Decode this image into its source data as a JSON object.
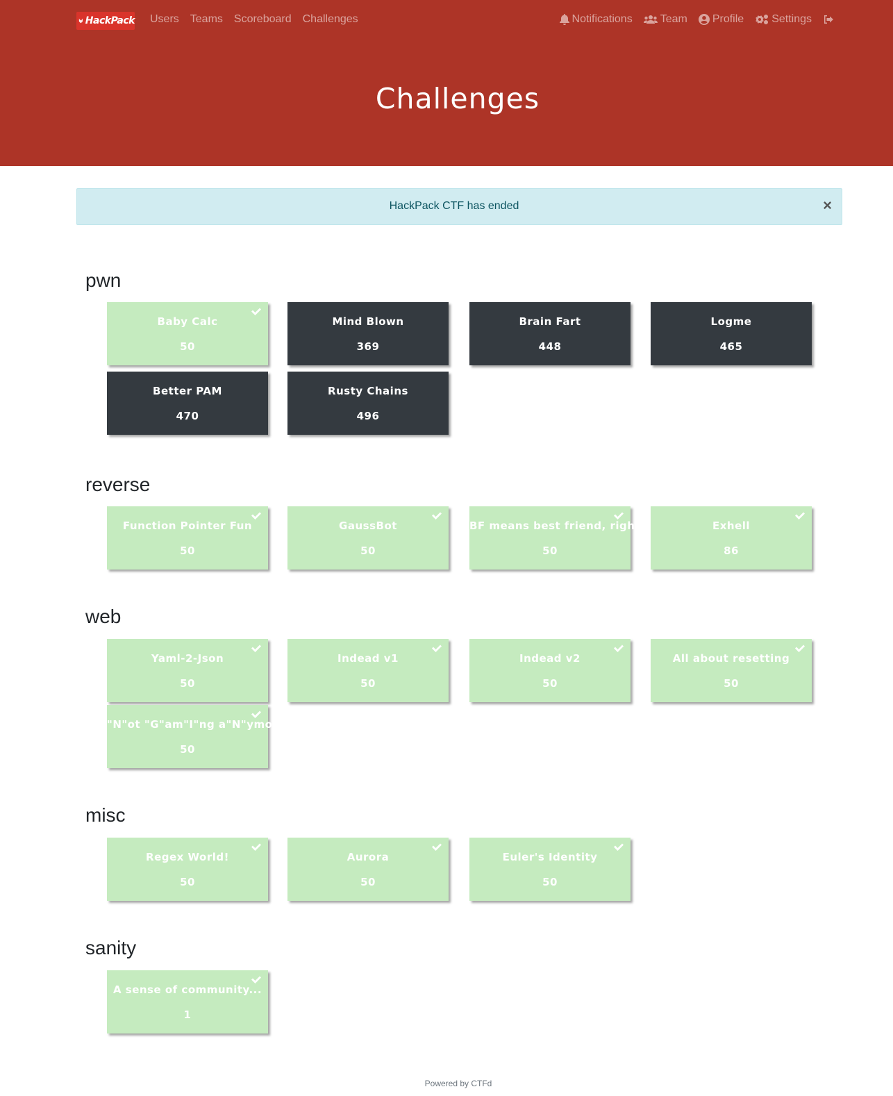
{
  "navbar": {
    "brand": "HackPack",
    "left_links": [
      "Users",
      "Teams",
      "Scoreboard",
      "Challenges"
    ],
    "right_items": [
      {
        "label": "Notifications",
        "icon": "bell-icon"
      },
      {
        "label": "Team",
        "icon": "users-icon"
      },
      {
        "label": "Profile",
        "icon": "user-circle-icon"
      },
      {
        "label": "Settings",
        "icon": "cogs-icon"
      }
    ],
    "logout_icon": "sign-out-icon"
  },
  "header": {
    "title": "Challenges"
  },
  "alert": {
    "message": "HackPack CTF has ended",
    "close": "×"
  },
  "categories": [
    {
      "name": "pwn",
      "challenges": [
        {
          "name": "Baby Calc",
          "points": "50",
          "solved": true
        },
        {
          "name": "Mind Blown",
          "points": "369",
          "solved": false
        },
        {
          "name": "Brain Fart",
          "points": "448",
          "solved": false
        },
        {
          "name": "Logme",
          "points": "465",
          "solved": false
        },
        {
          "name": "Better PAM",
          "points": "470",
          "solved": false
        },
        {
          "name": "Rusty Chains",
          "points": "496",
          "solved": false
        }
      ]
    },
    {
      "name": "reverse",
      "challenges": [
        {
          "name": "Function Pointer Fun",
          "points": "50",
          "solved": true
        },
        {
          "name": "GaussBot",
          "points": "50",
          "solved": true
        },
        {
          "name": "BF means best friend, right?",
          "points": "50",
          "solved": true
        },
        {
          "name": "Exhell",
          "points": "86",
          "solved": true
        }
      ]
    },
    {
      "name": "web",
      "challenges": [
        {
          "name": "Yaml-2-Json",
          "points": "50",
          "solved": true
        },
        {
          "name": "Indead v1",
          "points": "50",
          "solved": true
        },
        {
          "name": "Indead v2",
          "points": "50",
          "solved": true
        },
        {
          "name": "All about resetting",
          "points": "50",
          "solved": true
        },
        {
          "name": "\"N\"ot \"G\"am\"I\"ng a\"N\"ymore",
          "points": "50",
          "solved": true
        }
      ]
    },
    {
      "name": "misc",
      "challenges": [
        {
          "name": "Regex World!",
          "points": "50",
          "solved": true
        },
        {
          "name": "Aurora",
          "points": "50",
          "solved": true
        },
        {
          "name": "Euler's Identity",
          "points": "50",
          "solved": true
        }
      ]
    },
    {
      "name": "sanity",
      "challenges": [
        {
          "name": "A sense of community...",
          "points": "1",
          "solved": true
        }
      ]
    }
  ],
  "footer": {
    "text": "Powered by CTFd"
  },
  "colors": {
    "navbar": "#ad3427",
    "solved_card": "#c5ebbf",
    "unsolved_card": "#343a40",
    "alert_bg": "#d1ecf1"
  }
}
